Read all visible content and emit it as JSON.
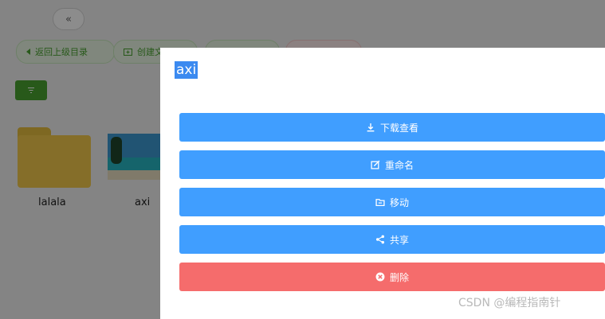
{
  "toolbar": {
    "collapse_icon": "double-chevron-left-icon",
    "back_label": "返回上级目录",
    "create_label": "创建文"
  },
  "files": [
    {
      "name": "lalala",
      "type": "folder"
    },
    {
      "name": "axi",
      "type": "image"
    }
  ],
  "dialog": {
    "title": "axi",
    "actions": {
      "download": "下载查看",
      "rename": "重命名",
      "move": "移动",
      "share": "共享",
      "delete": "删除"
    }
  },
  "watermark": "CSDN @编程指南针",
  "colors": {
    "primary": "#409eff",
    "danger": "#f56c6c",
    "success": "#4aa331",
    "folder": "#f2c94c"
  }
}
